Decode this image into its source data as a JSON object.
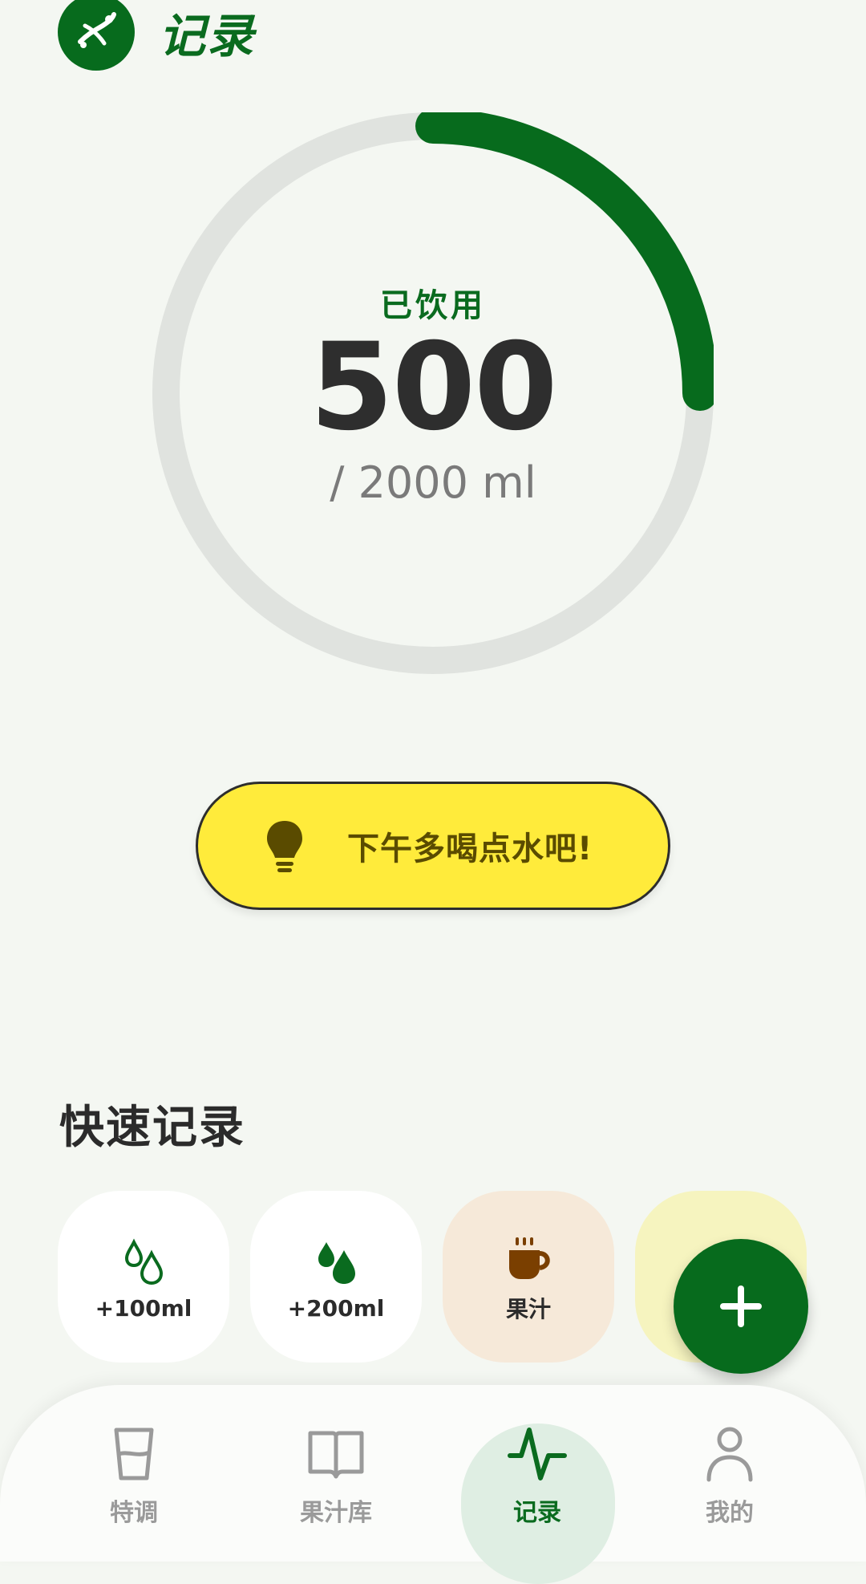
{
  "header": {
    "title": "记录",
    "logo_icon": "juice-fruit-logo-icon"
  },
  "progress": {
    "label": "已饮用",
    "value": "500",
    "goal_text": "/ 2000 ml",
    "consumed_ml": 500,
    "goal_ml": 2000,
    "fraction": 0.25,
    "colors": {
      "progress": "#076b1d",
      "track": "#e0e3df"
    }
  },
  "tip": {
    "text": "下午多喝点水吧!",
    "icon": "lightbulb-icon",
    "background": "#ffeb3b"
  },
  "quick_record": {
    "title": "快速记录",
    "items": [
      {
        "label": "+100ml",
        "icon": "water-drops-outline-icon"
      },
      {
        "label": "+200ml",
        "icon": "water-drops-filled-icon"
      },
      {
        "label": "果汁",
        "icon": "coffee-cup-icon"
      },
      {
        "label": "",
        "icon": "cup-icon"
      }
    ]
  },
  "fab": {
    "icon": "plus-icon"
  },
  "bottom_nav": {
    "items": [
      {
        "label": "特调",
        "icon": "glass-icon",
        "active": false
      },
      {
        "label": "果汁库",
        "icon": "open-book-icon",
        "active": false
      },
      {
        "label": "记录",
        "icon": "activity-pulse-icon",
        "active": true
      },
      {
        "label": "我的",
        "icon": "person-icon",
        "active": false
      }
    ],
    "active_color": "#0a6b1f",
    "inactive_color": "#9a9a9a"
  }
}
